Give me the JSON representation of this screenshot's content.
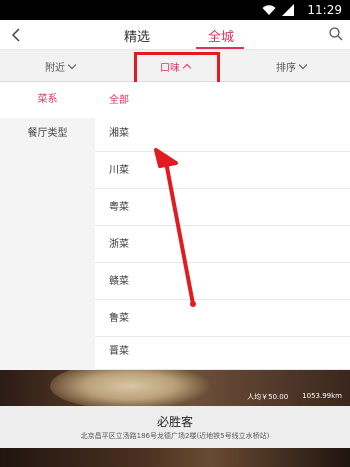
{
  "status_bar": {
    "time": "11:29",
    "icons": [
      "wifi-icon",
      "signal-icon"
    ]
  },
  "top_nav": {
    "tabs": [
      "精选",
      "全城"
    ],
    "active_tab": "全城"
  },
  "filter_bar": {
    "items": [
      "附近",
      "口味",
      "排序"
    ],
    "active": "口味"
  },
  "left_menu": {
    "items": [
      "菜系",
      "餐厅类型"
    ],
    "active": "菜系"
  },
  "right_menu": {
    "items": [
      "全部",
      "湘菜",
      "川菜",
      "粤菜",
      "浙菜",
      "赣菜",
      "鲁菜",
      "晋菜"
    ],
    "selected": "全部"
  },
  "restaurant": {
    "avg_price": "人均￥50.00",
    "distance": "1053.99km",
    "name": "必胜客",
    "address": "北京昌平区立汤路186号龙德广场2楼(近地铁5号线立水桥站)"
  },
  "colors": {
    "accent": "#e0315a",
    "annotation": "#e21b22"
  }
}
